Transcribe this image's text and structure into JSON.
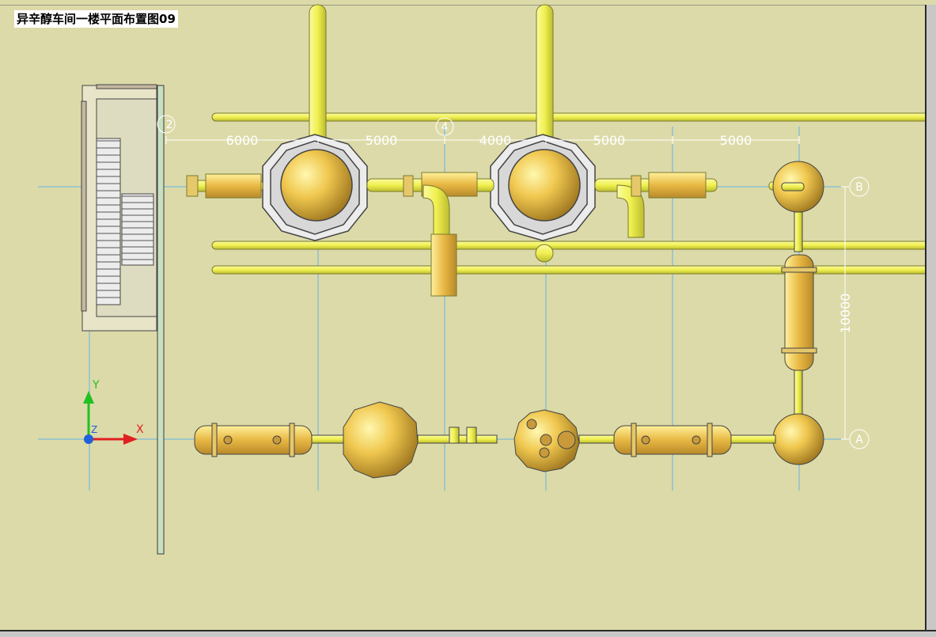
{
  "title": "异辛醇车间一楼平面布置图09",
  "dimensions": {
    "horizontal": [
      "6000",
      "5000",
      "4000",
      "5000",
      "5000"
    ],
    "vertical": "10000"
  },
  "grid_markers": {
    "col_2": "2",
    "col_4": "4",
    "row_A": "A",
    "row_B": "B"
  },
  "ucs": {
    "x_label": "X",
    "y_label": "Y",
    "z_label": "Z"
  },
  "colors": {
    "background": "#dcdaa8",
    "pipe": "#f2f25a",
    "equipment": "#e6b640",
    "grid_line": "#64b4e6",
    "dimension": "#ffffff"
  }
}
